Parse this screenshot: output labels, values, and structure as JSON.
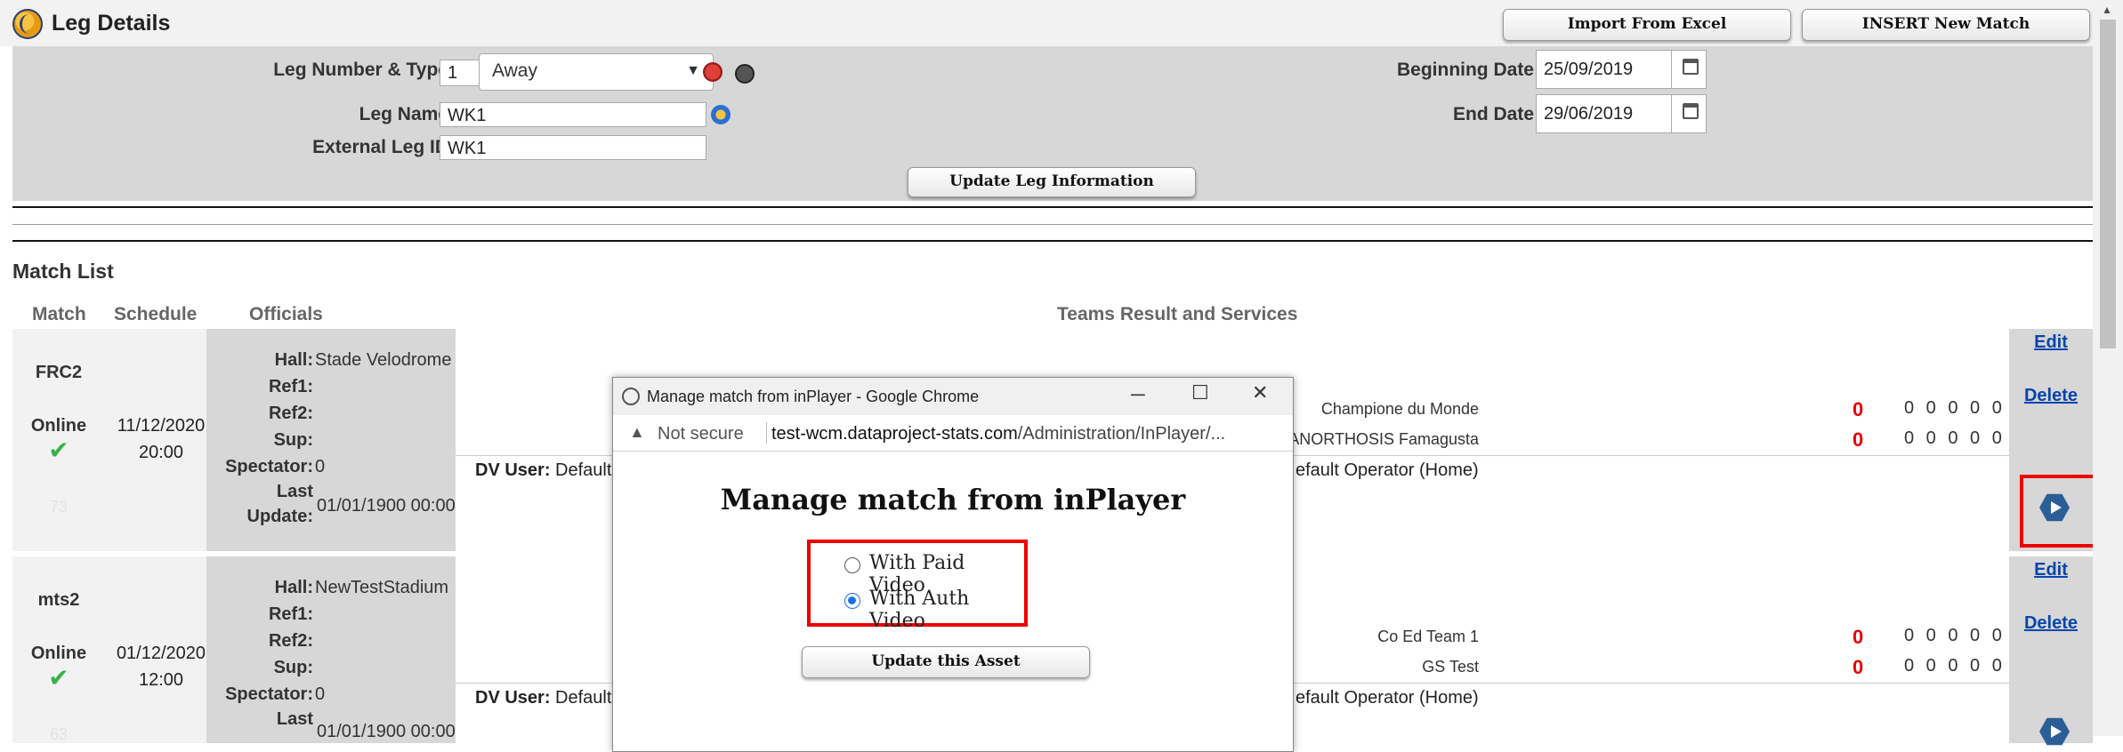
{
  "header": {
    "title": "Leg Details",
    "import_button": "Import From Excel",
    "insert_button": "INSERT New Match"
  },
  "leg": {
    "number_type_label": "Leg Number & Type",
    "number_value": "1",
    "type_value": "Away",
    "name_label": "Leg Name",
    "name_value": "WK1",
    "external_id_label": "External Leg ID",
    "external_id_value": "WK1",
    "beginning_date_label": "Beginning Date",
    "beginning_date_value": "25/09/2019",
    "end_date_label": "End Date",
    "end_date_value": "29/06/2019",
    "update_button": "Update Leg Information"
  },
  "match_list": {
    "title": "Match List",
    "columns": [
      "Match",
      "Schedule",
      "Officials",
      "Teams Result and Services"
    ],
    "officials_labels": {
      "hall": "Hall:",
      "ref1": "Ref1:",
      "ref2": "Ref2:",
      "sup": "Sup:",
      "spectator": "Spectator:",
      "last": "Last",
      "update": "Update:"
    },
    "dv_user_label": "DV User:",
    "edit_label": "Edit",
    "delete_label": "Delete",
    "rows": [
      {
        "code": "FRC2",
        "status": "Online",
        "id": "73",
        "date": "11/12/2020",
        "time": "20:00",
        "hall": "Stade Velodrome",
        "spectator": "0",
        "last_update": "01/01/1900 00:00",
        "dv_user_left": "Default C",
        "dv_user_right": "efault Operator (Home)",
        "team1": "Champione du Monde",
        "team1_score": "0",
        "team1_sets": "0 0 0 0 0",
        "team2": "ANORTHOSIS Famagusta",
        "team2_score": "0",
        "team2_sets": "0 0 0 0 0"
      },
      {
        "code": "mts2",
        "status": "Online",
        "id": "63",
        "date": "01/12/2020",
        "time": "12:00",
        "hall": "NewTestStadium",
        "spectator": "0",
        "last_update": "01/01/1900 00:00",
        "dv_user_left": "Default C",
        "dv_user_right": "efault Operator (Home)",
        "team1": "Co Ed Team 1",
        "team1_score": "0",
        "team1_sets": "0 0 0 0 0",
        "team2": "GS Test",
        "team2_score": "0",
        "team2_sets": "0 0 0 0 0"
      }
    ]
  },
  "popup": {
    "window_title": "Manage match from inPlayer - Google Chrome",
    "not_secure": "Not secure",
    "url_domain": "test-wcm.dataproject-stats.com",
    "url_path": "/Administration/InPlayer/...",
    "heading": "Manage match from inPlayer",
    "option_paid": "With Paid Video",
    "option_auth": "With Auth Video",
    "selected_option": "With Auth Video",
    "update_button": "Update this Asset"
  },
  "colors": {
    "panel_gray": "#d7d7d7",
    "highlight_red": "#e00000",
    "score_red": "#e60000",
    "link_blue": "#0645ad",
    "check_green": "#36b24a"
  }
}
